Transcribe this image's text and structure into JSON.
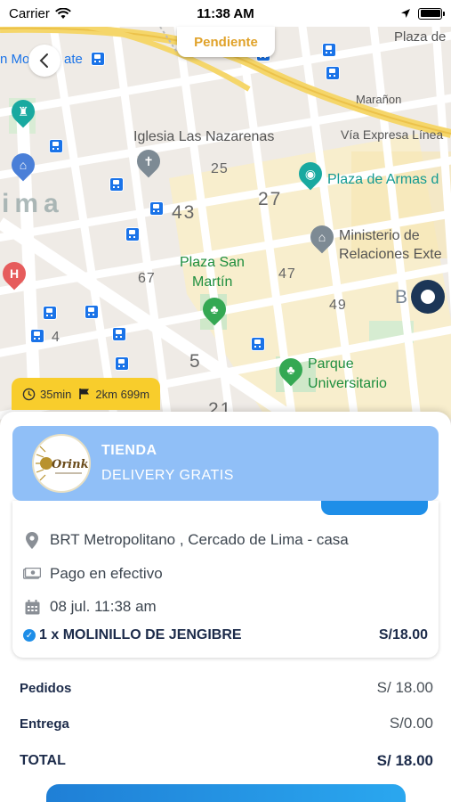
{
  "status_bar": {
    "carrier": "Carrier",
    "time": "11:38 AM"
  },
  "header": {
    "status_badge": "Pendiente"
  },
  "map": {
    "labels": {
      "plaza_de": "Plaza de",
      "monte": "n Mo",
      "ate": "ate",
      "maranon": "Marañon",
      "via_expresa": "Vía Expresa Línea",
      "iglesia": "Iglesia Las Nazarenas",
      "plaza_armas": "Plaza de Armas d",
      "n25": "25",
      "n27": "27",
      "n43": "43",
      "lima": "ima",
      "ministerio_1": "Ministerio de",
      "ministerio_2": "Relaciones Exte",
      "plaza_san_1": "Plaza San",
      "plaza_san_2": "Martín",
      "n67": "67",
      "n47": "47",
      "n49": "49",
      "n4": "4",
      "n5": "5",
      "parque_1": "Parque",
      "parque_2": "Universitario",
      "n21": "21",
      "b": "B"
    }
  },
  "eta": {
    "time": "35min",
    "distance": "2km 699m"
  },
  "store": {
    "name": "TIENDA",
    "subtitle": "DELIVERY GRATIS",
    "logo_text": "Orinka"
  },
  "order": {
    "address": "BRT Metropolitano , Cercado de Lima - casa",
    "payment": "Pago en efectivo",
    "date": "08 jul. 11:38 am",
    "product": "1 x MOLINILLO  DE JENGIBRE",
    "product_price": "S/18.00"
  },
  "totals": {
    "pedidos_label": "Pedidos",
    "pedidos_value": "S/ 18.00",
    "entrega_label": "Entrega",
    "entrega_value": "S/0.00",
    "total_label": "TOTAL",
    "total_value": "S/ 18.00"
  },
  "colors": {
    "accent_blue": "#1e8ee8",
    "store_card": "#90bff7",
    "eta_yellow": "#f8cd2c",
    "pending_orange": "#e0a22a"
  }
}
